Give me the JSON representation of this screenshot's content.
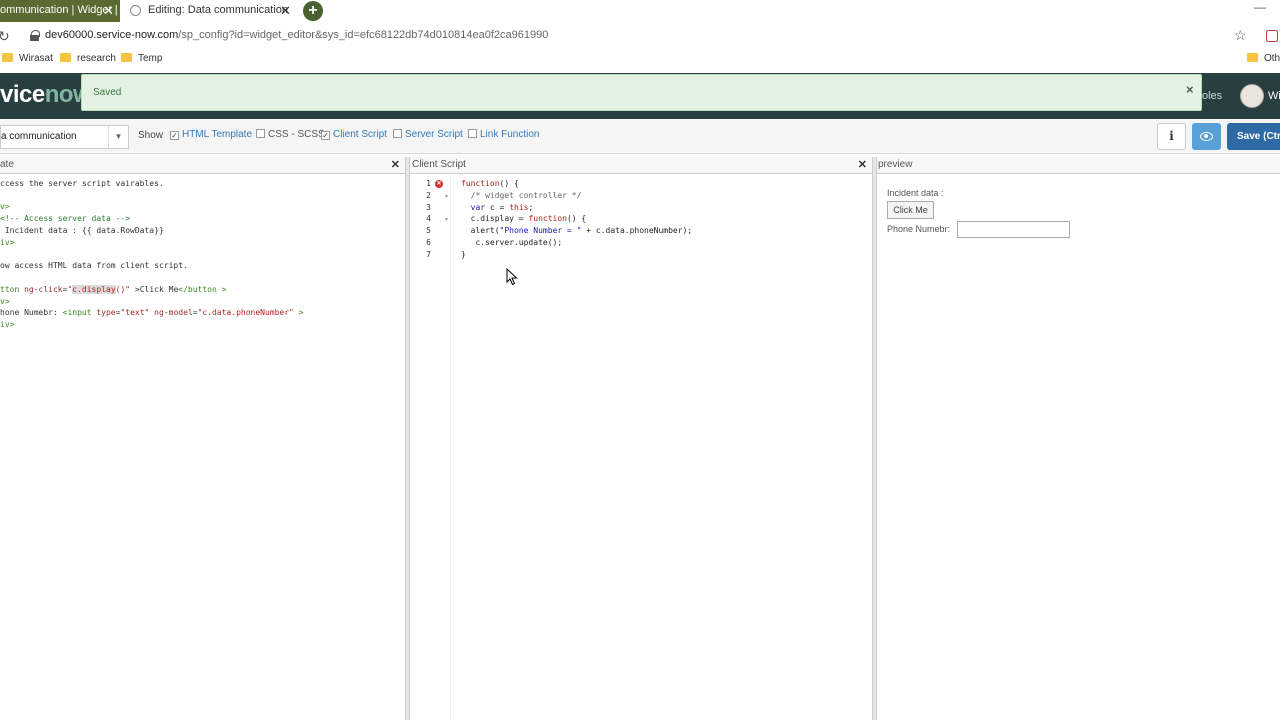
{
  "browser": {
    "tabs": [
      {
        "label": "ommunication | Widget | S",
        "active": true
      },
      {
        "label": "Editing: Data communication",
        "active": false
      }
    ],
    "url_host": "dev60000.service-now.com",
    "url_path": "/sp_config?id=widget_editor&sys_id=efc68122db74d010814ea0f2ca961990",
    "bookmarks": [
      "Wirasat",
      "research",
      "Temp",
      "Oth"
    ]
  },
  "header": {
    "logo_prefix": "vice",
    "logo_now": "now",
    "right_text": "oles",
    "user": "Wi"
  },
  "notification": {
    "message": "Saved"
  },
  "toolbar": {
    "widget_name": "a communication",
    "show_label": "Show",
    "options": [
      {
        "label": "HTML Template",
        "checked": true
      },
      {
        "label": "CSS - SCSS",
        "checked": false
      },
      {
        "label": "Client Script",
        "checked": true
      },
      {
        "label": "Server Script",
        "checked": false
      },
      {
        "label": "Link Function",
        "checked": false
      }
    ],
    "info_label": "i",
    "save_label": "Save (Ctrl"
  },
  "html_pane": {
    "title": "ate",
    "lines": [
      "ccess the server script vairables.",
      "",
      "v>",
      "<!-- Access server data -->",
      " Incident data : {{ data.RowData}}",
      "iv>",
      "",
      "ow access HTML data from client script.",
      "",
      "tton ng-click=\"c.display()\" >Click Me</button >",
      "v>",
      "hone Numebr: <input type=\"text\" ng-model=\"c.data.phoneNumber\" >",
      "iv>"
    ]
  },
  "client_pane": {
    "title": "Client Script",
    "line_numbers": [
      "1",
      "2",
      "3",
      "4",
      "5",
      "6",
      "7"
    ],
    "lines": [
      "function() {",
      "  /* widget controller */",
      "  var c = this;",
      "  c.display = function() {",
      "  alert(\"Phone Number = \" + c.data.phoneNumber);",
      "   c.server.update();",
      "}"
    ]
  },
  "preview_pane": {
    "title": "preview",
    "incident_label": "Incident data :",
    "button_label": "Click Me",
    "phone_label": "Phone Numebr:",
    "phone_value": ""
  },
  "colors": {
    "header_bg": "#293e40",
    "tab_active": "#5a6a32",
    "save_btn": "#2e6aa5",
    "notify_bg": "#e4f2e4"
  }
}
